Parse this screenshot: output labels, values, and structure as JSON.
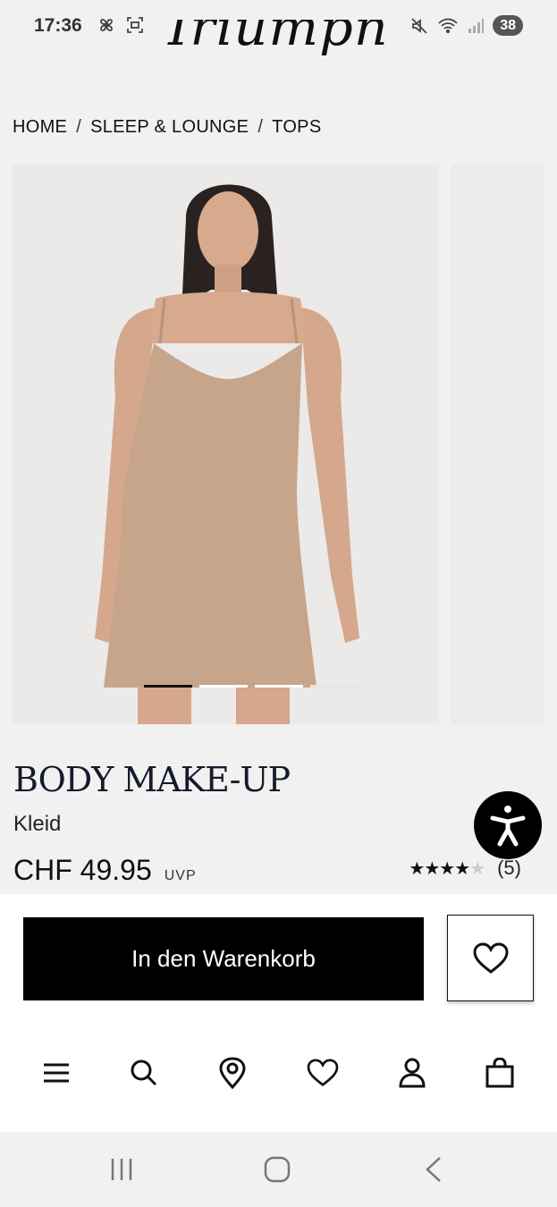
{
  "status_bar": {
    "time": "17:36",
    "battery": "38",
    "icons_left": [
      "fan-icon",
      "screenshot-icon"
    ],
    "icons_right": [
      "mute-icon",
      "wifi-icon",
      "signal-icon"
    ]
  },
  "header": {
    "logo": "Iriumpn"
  },
  "breadcrumb": {
    "items": [
      "HOME",
      "SLEEP & LOUNGE",
      "TOPS"
    ],
    "separator": "/"
  },
  "gallery": {
    "slide_count": 4,
    "active_slide": 1
  },
  "product": {
    "brand": "BODY MAKE-UP",
    "type": "Kleid",
    "price": "CHF 49.95",
    "price_note": "UVP",
    "rating_value": 4.5,
    "rating_max": 5,
    "review_count": "(5)"
  },
  "actions": {
    "add_to_cart": "In den Warenkorb",
    "wishlist_icon": "heart-icon"
  },
  "bottom_nav": {
    "items": [
      "menu-icon",
      "search-icon",
      "location-icon",
      "heart-icon",
      "user-icon",
      "bag-icon"
    ]
  },
  "system_nav": {
    "items": [
      "recents-icon",
      "home-icon",
      "back-icon"
    ]
  },
  "colors": {
    "accent": "#000000",
    "background": "#f2f1f1",
    "brand_text": "#151a2c"
  }
}
